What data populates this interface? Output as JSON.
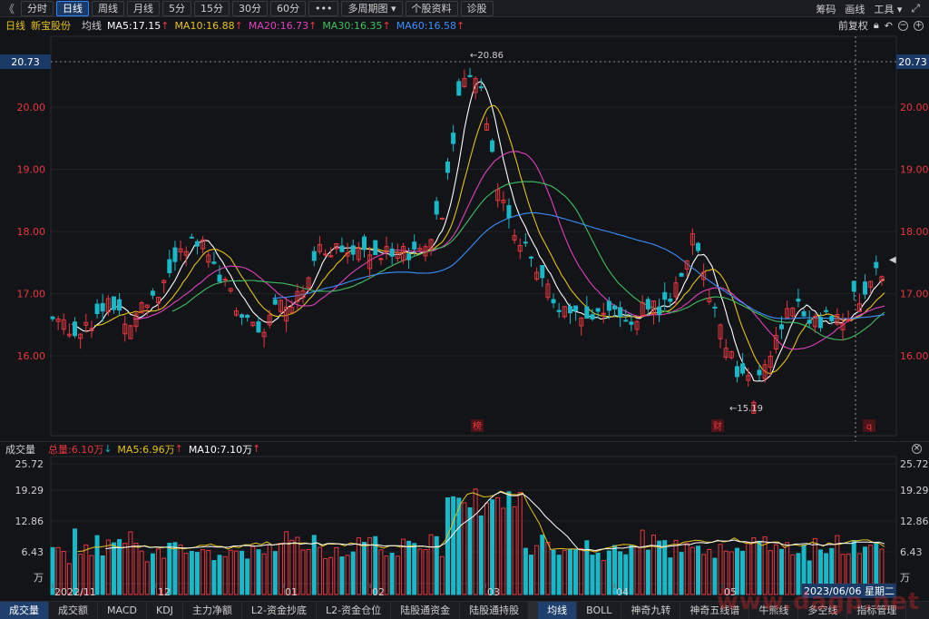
{
  "toolbar": {
    "back_label": "《",
    "periods": [
      "分时",
      "日线",
      "周线",
      "月线",
      "5分",
      "15分",
      "30分",
      "60分",
      "•••",
      "多周期图 ▾",
      "个股资料",
      "诊股"
    ],
    "active_index": 1,
    "right": [
      "筹码",
      "画线",
      "工具 ▾"
    ]
  },
  "infoline": {
    "period": "日线",
    "stock_name": "新宝股份",
    "ma_label": "均线",
    "ma5": "MA5:17.15",
    "ma10": "MA10:16.88",
    "ma20": "MA20:16.73",
    "ma30": "MA30:16.35",
    "ma60": "MA60:16.58",
    "fq": "前复权"
  },
  "colors": {
    "up": "#e8373f",
    "down": "#18b8c8",
    "ma5": "#ffffff",
    "ma10": "#e6c21a",
    "ma20": "#e040c0",
    "ma30": "#40c060",
    "ma60": "#3a90ff"
  },
  "chart_data": {
    "type": "candlestick",
    "y_ticks": [
      "20.00",
      "19.00",
      "18.00",
      "17.00",
      "16.00"
    ],
    "y_marker": "20.73",
    "high_label": "20.86",
    "low_label": "15.19",
    "x_labels": [
      "2022/11",
      "12",
      "01",
      "02",
      "03",
      "04",
      "05"
    ],
    "event_marks": [
      "榜",
      "财",
      "q"
    ],
    "volume_ticks": [
      "25.72",
      "19.29",
      "12.86",
      "6.43",
      "万"
    ],
    "date_badge": "2023/06/06 星期二"
  },
  "volline": {
    "label": "成交量",
    "total": "总量:6.10万",
    "ma5": "MA5:6.96万",
    "ma10": "MA10:7.10万"
  },
  "tabs": [
    "成交量",
    "成交额",
    "MACD",
    "KDJ",
    "主力净额",
    "L2-资金抄底",
    "L2-资金仓位",
    "陆股通资金",
    "陆股通持股",
    "均线",
    "BOLL",
    "神奇九转",
    "神奇五线谱",
    "牛熊线",
    "多空线",
    "指标管理"
  ],
  "watermark": "www.dagp.net"
}
